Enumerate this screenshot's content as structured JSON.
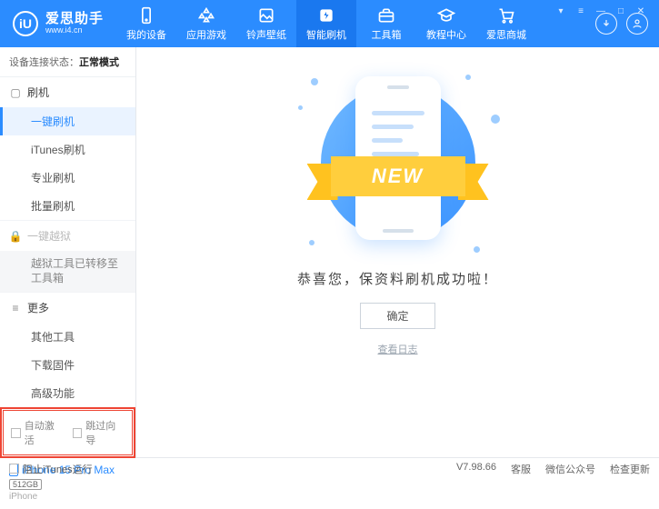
{
  "brand": {
    "name": "爱思助手",
    "url": "www.i4.cn",
    "logo_letter": "iU"
  },
  "nav": {
    "items": [
      {
        "label": "我的设备"
      },
      {
        "label": "应用游戏"
      },
      {
        "label": "铃声壁纸"
      },
      {
        "label": "智能刷机"
      },
      {
        "label": "工具箱"
      },
      {
        "label": "教程中心"
      },
      {
        "label": "爱思商城"
      }
    ]
  },
  "status": {
    "prefix": "设备连接状态：",
    "value": "正常模式"
  },
  "sidebar": {
    "flash": {
      "title": "刷机",
      "items": [
        "一键刷机",
        "iTunes刷机",
        "专业刷机",
        "批量刷机"
      ]
    },
    "jailbreak": {
      "title": "一键越狱",
      "note": "越狱工具已转移至工具箱"
    },
    "more": {
      "title": "更多",
      "items": [
        "其他工具",
        "下载固件",
        "高级功能"
      ]
    }
  },
  "checks": {
    "auto_activate": "自动激活",
    "skip_guide": "跳过向导"
  },
  "device": {
    "name": "iPhone 15 Pro Max",
    "storage": "512GB",
    "type": "iPhone"
  },
  "main": {
    "ribbon": "NEW",
    "success": "恭喜您，保资料刷机成功啦！",
    "ok": "确定",
    "log_link": "查看日志"
  },
  "footer": {
    "block_itunes": "阻止iTunes运行",
    "version": "V7.98.66",
    "links": [
      "客服",
      "微信公众号",
      "检查更新"
    ]
  }
}
